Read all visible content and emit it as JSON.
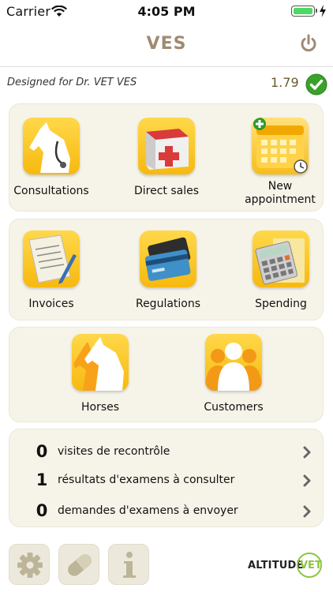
{
  "status_bar": {
    "carrier": "Carrier",
    "time": "4:05 PM"
  },
  "header": {
    "title": "VES",
    "title_color": "#a08a72",
    "power_icon": "power-icon"
  },
  "info": {
    "designed_for": "Designed for Dr. VET VES",
    "version": "1.79",
    "status_icon": "check-circle-icon"
  },
  "grid1": {
    "consultations": "Consultations",
    "direct_sales": "Direct sales",
    "new_appointment": "New appointment"
  },
  "grid2": {
    "invoices": "Invoices",
    "regulations": "Regulations",
    "spending": "Spending"
  },
  "grid3": {
    "horses": "Horses",
    "customers": "Customers"
  },
  "summary": [
    {
      "count": "0",
      "label": "visites de recontrôle"
    },
    {
      "count": "1",
      "label": "résultats d'examens à consulter"
    },
    {
      "count": "0",
      "label": "demandes d'examens à envoyer"
    }
  ],
  "toolbar": {
    "settings_icon": "gear-icon",
    "pills_icon": "pill-icon",
    "info_icon": "info-icon"
  },
  "brand": {
    "left": "ALTITUDE",
    "right": "VET",
    "accent": "#8cc63f"
  },
  "colors": {
    "panel_bg": "#f6f4e9",
    "tile_yellow": "#f7b90f",
    "check_green": "#3aa12a"
  }
}
